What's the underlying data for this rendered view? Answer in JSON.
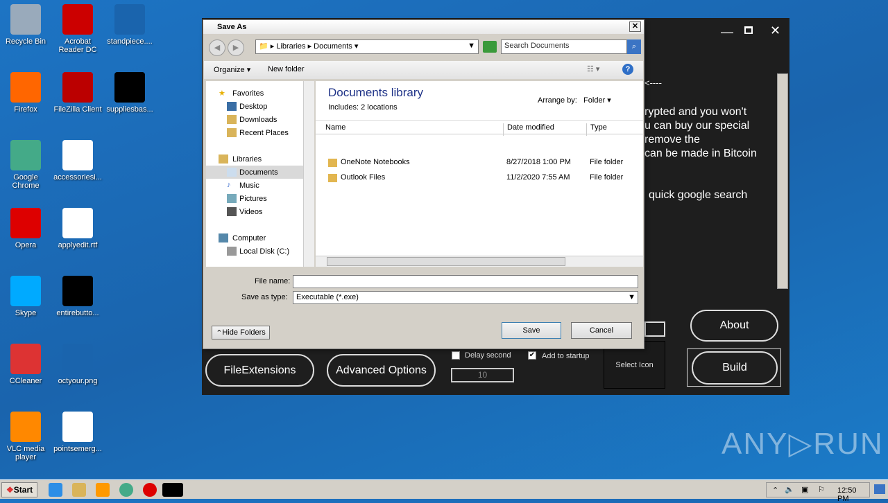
{
  "desktop": {
    "icons": [
      {
        "label": "Recycle Bin",
        "color": "#9ab"
      },
      {
        "label": "Acrobat Reader DC",
        "color": "#c00"
      },
      {
        "label": "standpiece....",
        "color": "#1a64ad"
      },
      {
        "label": "Firefox",
        "color": "#f60"
      },
      {
        "label": "FileZilla Client",
        "color": "#b00"
      },
      {
        "label": "suppliesbas...",
        "color": "#000"
      },
      {
        "label": "Google Chrome",
        "color": "#4a8"
      },
      {
        "label": "accessoriesi...",
        "color": "#fff"
      },
      {
        "label": "Opera",
        "color": "#d00"
      },
      {
        "label": "applyedit.rtf",
        "color": "#fff"
      },
      {
        "label": "Skype",
        "color": "#0af"
      },
      {
        "label": "entirebutto...",
        "color": "#000"
      },
      {
        "label": "CCleaner",
        "color": "#d33"
      },
      {
        "label": "octyour.png",
        "color": "#1a64ad"
      },
      {
        "label": "VLC media player",
        "color": "#f80"
      },
      {
        "label": "pointsemerg...",
        "color": "#fff"
      }
    ]
  },
  "app": {
    "text_lines": [
      "<----",
      "rypted and you won't",
      "u can buy our special",
      "remove the",
      "can be made in Bitcoin",
      "quick google search"
    ],
    "buttons": {
      "file_extensions": "FileExtensions",
      "advanced": "Advanced Options",
      "about": "About",
      "build": "Build",
      "select_icon": "Select Icon"
    },
    "delay_label": "Delay second",
    "delay_checked": false,
    "startup_label": "Add to startup",
    "startup_checked": true,
    "delay_value": "10"
  },
  "dialog": {
    "title": "Save As",
    "breadcrumb": [
      "Libraries",
      "Documents"
    ],
    "search_placeholder": "Search Documents",
    "organize": "Organize",
    "new_folder": "New folder",
    "nav": {
      "favorites": "Favorites",
      "fav_items": [
        "Desktop",
        "Downloads",
        "Recent Places"
      ],
      "libraries": "Libraries",
      "lib_items": [
        "Documents",
        "Music",
        "Pictures",
        "Videos"
      ],
      "computer": "Computer",
      "comp_items": [
        "Local Disk (C:)"
      ]
    },
    "library_title": "Documents library",
    "includes_label": "Includes:",
    "includes_link": "2 locations",
    "arrange_label": "Arrange by:",
    "arrange_value": "Folder",
    "columns": [
      "Name",
      "Date modified",
      "Type"
    ],
    "files": [
      {
        "name": "OneNote Notebooks",
        "date": "8/27/2018 1:00 PM",
        "type": "File folder"
      },
      {
        "name": "Outlook Files",
        "date": "11/2/2020 7:55 AM",
        "type": "File folder"
      }
    ],
    "file_name_label": "File name:",
    "file_name_value": "",
    "save_type_label": "Save as type:",
    "save_type_value": "Executable (*.exe)",
    "hide_folders": "Hide Folders",
    "save": "Save",
    "cancel": "Cancel"
  },
  "taskbar": {
    "start": "Start",
    "clock": "12:50 PM"
  },
  "watermark": "ANY RUN"
}
